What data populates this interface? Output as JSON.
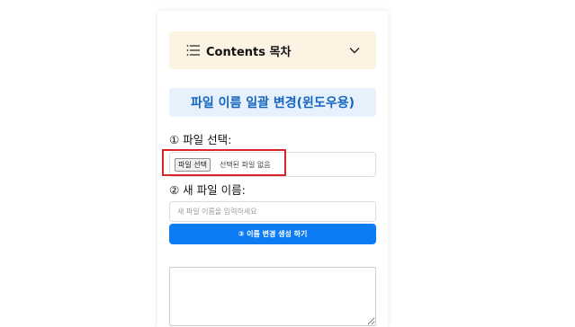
{
  "toc": {
    "title": "Contents 목차",
    "icon": "list-icon",
    "toggle_icon": "chevron-down-icon",
    "background": "#fdf3e3"
  },
  "heading": {
    "text": "파일 이름 일괄 변경(윈도우용)",
    "color": "#1565c0",
    "background": "#e6f1fc"
  },
  "step1": {
    "label": "① 파일 선택:",
    "button_label": "파일 선택",
    "status_text": "선택된 파일 없음"
  },
  "step2": {
    "label": "② 새 파일 이름:",
    "placeholder": "새 파일 이름을 입력하세요",
    "value": ""
  },
  "generate_button": {
    "label": "③ 이름 변경 생성 하기",
    "color": "#0d7cf2"
  },
  "result": {
    "value": ""
  },
  "highlight_color": "#d9252a"
}
